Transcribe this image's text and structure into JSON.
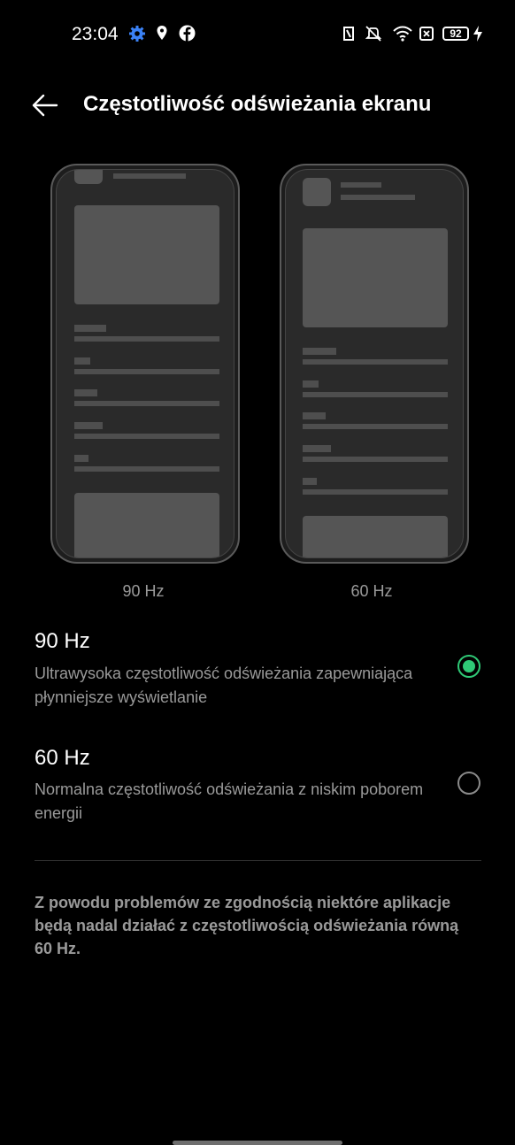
{
  "status_bar": {
    "time": "23:04",
    "battery_level": "92",
    "icons": [
      "settings-gear-icon",
      "location-icon",
      "facebook-icon",
      "nfc-icon",
      "vibrate-off-icon",
      "wifi-icon",
      "sim-x-icon",
      "battery-icon",
      "charging-icon"
    ]
  },
  "header": {
    "title": "Częstotliwość odświeżania ekranu",
    "back_icon": "arrow-left-icon"
  },
  "previews": [
    {
      "caption": "90 Hz"
    },
    {
      "caption": "60 Hz"
    }
  ],
  "options": [
    {
      "title": "90 Hz",
      "description": "Ultrawysoka częstotliwość odświeżania zapewniająca płynniejsze wyświetlanie",
      "selected": true
    },
    {
      "title": "60 Hz",
      "description": "Normalna częstotliwość odświeżania z niskim poborem energii",
      "selected": false
    }
  ],
  "note": "Z powodu problemów ze zgodnością niektóre aplikacje będą nadal działać z częstotliwością odświeżania równą 60 Hz.",
  "colors": {
    "accent": "#2fc976",
    "background": "#000000",
    "secondary_text": "#9a9a9a"
  }
}
